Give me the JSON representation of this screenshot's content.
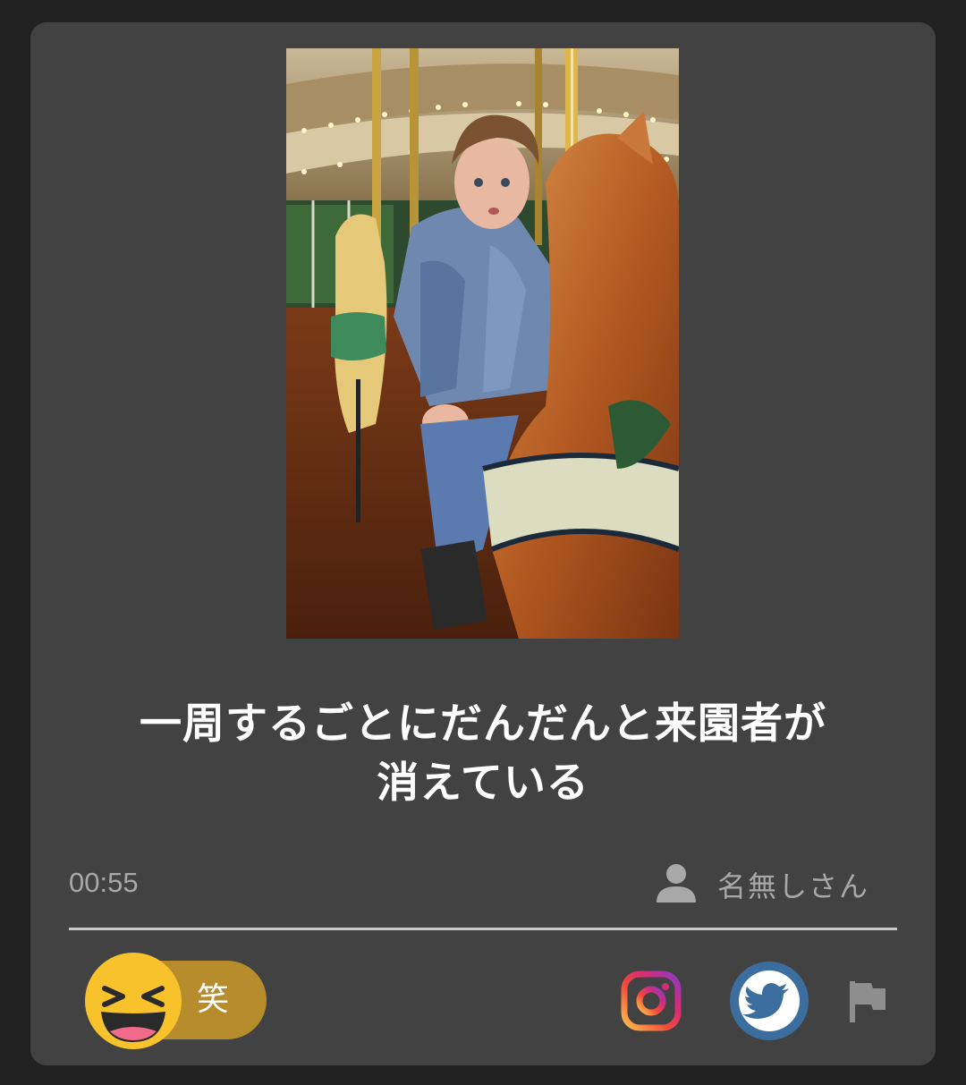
{
  "post": {
    "image_alt": "child riding carousel",
    "caption_line1": "一周するごとにだんだんと来園者が",
    "caption_line2": "消えている",
    "time": "00:55",
    "author": "名無しさん"
  },
  "reaction": {
    "label": "笑",
    "pill_color": "#b68c2c",
    "face_color": "#f7c22c"
  },
  "share": {
    "instagram_icon": "instagram-icon",
    "twitter_icon": "twitter-icon",
    "twitter_color": "#3b6e9f",
    "report_icon": "flag-icon"
  },
  "colors": {
    "background": "#222222",
    "card": "#424242",
    "muted_text": "#a8a8a8"
  }
}
